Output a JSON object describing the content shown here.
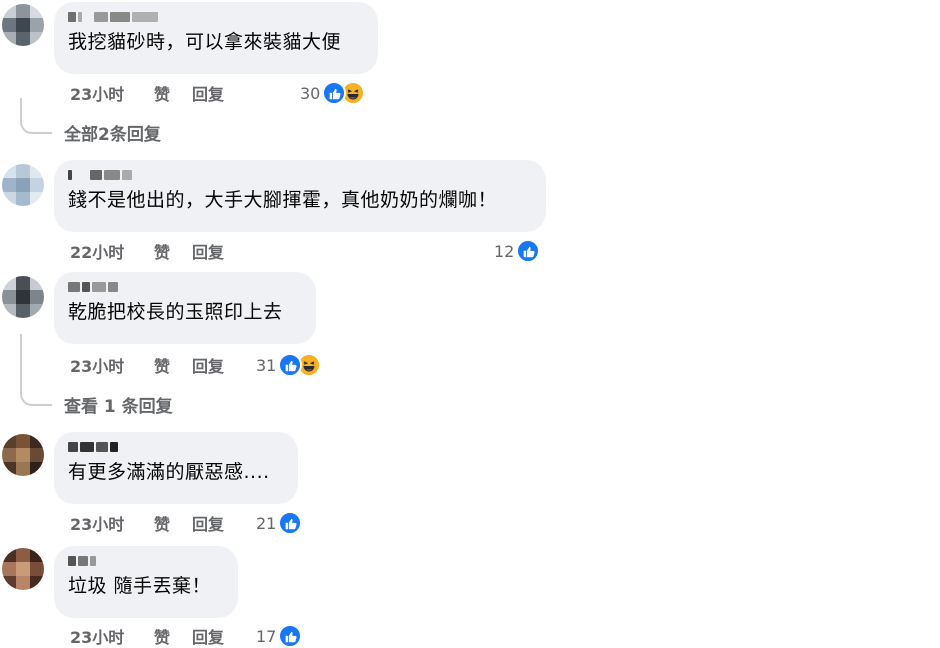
{
  "comments": [
    {
      "text": "我挖貓砂時，可以拿來裝貓大便",
      "time": "23小时",
      "like_label": "赞",
      "reply_label": "回复",
      "count": "30",
      "reactions": [
        "like",
        "haha"
      ],
      "replies_link": "全部2条回复"
    },
    {
      "text": "錢不是他出的，大手大腳揮霍，真他奶奶的爛咖！",
      "time": "22小时",
      "like_label": "赞",
      "reply_label": "回复",
      "count": "12",
      "reactions": [
        "like"
      ]
    },
    {
      "text": "乾脆把校長的玉照印上去",
      "time": "23小时",
      "like_label": "赞",
      "reply_label": "回复",
      "count": "31",
      "reactions": [
        "like",
        "haha"
      ],
      "replies_link": "查看 1 条回复"
    },
    {
      "text": "有更多滿滿的厭惡感....",
      "time": "23小时",
      "like_label": "赞",
      "reply_label": "回复",
      "count": "21",
      "reactions": [
        "like"
      ]
    },
    {
      "text": "垃圾 隨手丟棄！",
      "time": "23小时",
      "like_label": "赞",
      "reply_label": "回复",
      "count": "17",
      "reactions": [
        "like"
      ]
    }
  ],
  "colors": {
    "bubble": "#eff1f4",
    "meta_text": "#65676b",
    "like_blue": "#1877f2",
    "haha_yellow": "#f7b125"
  },
  "icons": {
    "like": "thumbs-up-icon",
    "haha": "laughing-face-icon"
  }
}
